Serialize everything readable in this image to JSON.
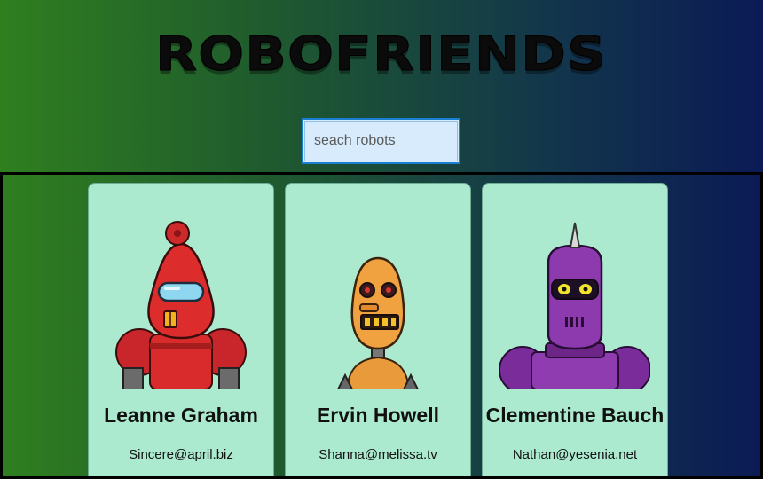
{
  "app": {
    "title": "ROBOFRIENDS"
  },
  "search": {
    "placeholder": "seach robots",
    "value": ""
  },
  "robots": [
    {
      "name": "Leanne Graham",
      "email": "Sincere@april.biz",
      "avatar": "red-robot-image"
    },
    {
      "name": "Ervin Howell",
      "email": "Shanna@melissa.tv",
      "avatar": "orange-robot-image"
    },
    {
      "name": "Clementine Bauch",
      "email": "Nathan@yesenia.net",
      "avatar": "purple-robot-image"
    }
  ],
  "colors": {
    "card_background": "#acead0",
    "search_background": "#d7ebfd",
    "gradient_start": "#2f7f1f",
    "gradient_end": "#0b1a55"
  }
}
